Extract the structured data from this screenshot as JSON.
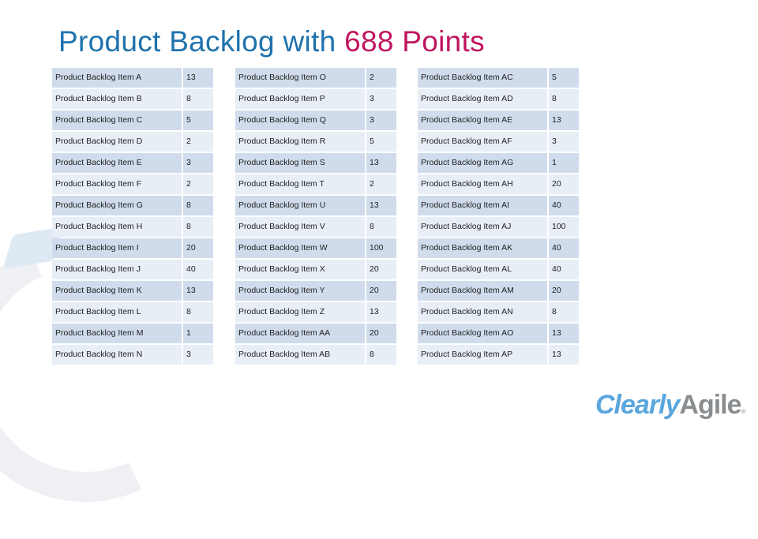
{
  "title": {
    "prefix": "Product Backlog with ",
    "highlight": "688 Points"
  },
  "colors": {
    "title": "#1f72ad",
    "highlight": "#c0145f",
    "row_dark": "#d0dcec",
    "row_light": "#e8eef6"
  },
  "tables": [
    {
      "rows": [
        {
          "name": "Product Backlog Item A",
          "points": "13"
        },
        {
          "name": "Product Backlog Item B",
          "points": "8"
        },
        {
          "name": "Product Backlog Item C",
          "points": "5"
        },
        {
          "name": "Product Backlog Item D",
          "points": "2"
        },
        {
          "name": "Product Backlog Item E",
          "points": "3"
        },
        {
          "name": "Product Backlog Item F",
          "points": "2"
        },
        {
          "name": "Product Backlog Item G",
          "points": "8"
        },
        {
          "name": "Product Backlog Item H",
          "points": "8"
        },
        {
          "name": "Product Backlog Item I",
          "points": "20"
        },
        {
          "name": "Product Backlog Item J",
          "points": "40"
        },
        {
          "name": "Product Backlog Item K",
          "points": "13"
        },
        {
          "name": "Product Backlog Item L",
          "points": "8"
        },
        {
          "name": "Product Backlog Item M",
          "points": "1"
        },
        {
          "name": "Product Backlog Item N",
          "points": "3"
        }
      ]
    },
    {
      "rows": [
        {
          "name": "Product Backlog Item O",
          "points": "2"
        },
        {
          "name": "Product Backlog Item P",
          "points": "3"
        },
        {
          "name": "Product Backlog Item Q",
          "points": "3"
        },
        {
          "name": "Product Backlog Item R",
          "points": "5"
        },
        {
          "name": "Product Backlog Item S",
          "points": "13"
        },
        {
          "name": "Product Backlog Item T",
          "points": "2"
        },
        {
          "name": "Product Backlog Item U",
          "points": "13"
        },
        {
          "name": "Product Backlog Item V",
          "points": "8"
        },
        {
          "name": "Product Backlog Item W",
          "points": "100"
        },
        {
          "name": "Product Backlog Item X",
          "points": "20"
        },
        {
          "name": "Product Backlog Item Y",
          "points": "20"
        },
        {
          "name": "Product Backlog Item Z",
          "points": "13"
        },
        {
          "name": "Product Backlog Item AA",
          "points": "20"
        },
        {
          "name": "Product Backlog Item AB",
          "points": "8"
        }
      ]
    },
    {
      "rows": [
        {
          "name": "Product Backlog Item AC",
          "points": "5"
        },
        {
          "name": "Product Backlog Item AD",
          "points": "8"
        },
        {
          "name": "Product Backlog Item AE",
          "points": "13"
        },
        {
          "name": "Product Backlog Item AF",
          "points": "3"
        },
        {
          "name": "Product Backlog Item AG",
          "points": "1"
        },
        {
          "name": "Product Backlog Item AH",
          "points": "20"
        },
        {
          "name": "Product Backlog Item AI",
          "points": "40"
        },
        {
          "name": "Product Backlog Item AJ",
          "points": "100"
        },
        {
          "name": "Product Backlog Item AK",
          "points": "40"
        },
        {
          "name": "Product Backlog Item AL",
          "points": "40"
        },
        {
          "name": "Product Backlog Item AM",
          "points": "20"
        },
        {
          "name": "Product Backlog Item AN",
          "points": "8"
        },
        {
          "name": "Product Backlog Item AO",
          "points": "13"
        },
        {
          "name": "Product Backlog Item AP",
          "points": "13"
        }
      ]
    }
  ],
  "logo": {
    "part1": "Clearly",
    "part2": "Agile",
    "mark": "®"
  }
}
